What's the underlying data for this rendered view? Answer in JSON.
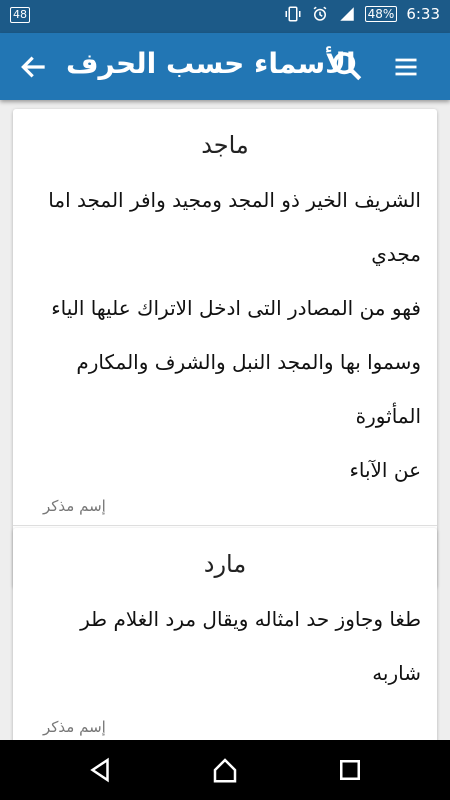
{
  "status_bar": {
    "notification_count": "48",
    "battery": "48%",
    "time": "6:33",
    "icons": [
      "vibrate-icon",
      "alarm-icon",
      "signal-icon",
      "battery-icon"
    ]
  },
  "app_bar": {
    "title": "الأسماء حسب الحرف",
    "icons": [
      "back-arrow-icon",
      "search-icon",
      "hamburger-menu-icon"
    ]
  },
  "names": [
    {
      "name": "ماجد",
      "meaning_lines": [
        "الشريف الخير ذو المجد ومجيد وافر المجد اما مجدي",
        "فهو من المصادر التى ادخل الاتراك عليها الياء",
        "وسموا بها والمجد النبل والشرف والمكارم المأثورة",
        "عن الآباء"
      ],
      "gender": "إسم مذكر"
    },
    {
      "name": "مارد",
      "meaning_lines": [
        "طغا وجاوز حد امثاله ويقال مرد الغلام طر شاربه"
      ],
      "gender": "إسم مذكر"
    }
  ],
  "colors": {
    "status_bar": "#1c5a88",
    "app_bar": "#2276b4",
    "background": "#eeeeee",
    "card": "#ffffff",
    "action_icon": "#9e9e9e"
  }
}
